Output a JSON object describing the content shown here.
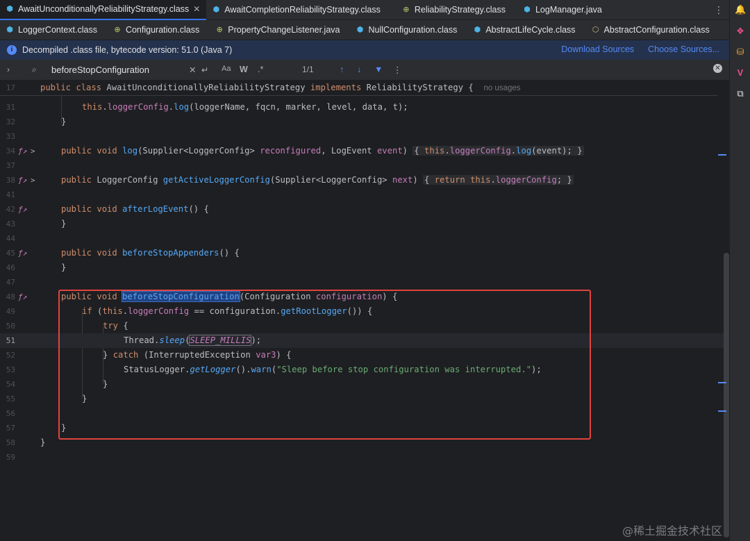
{
  "tabs_row1": [
    {
      "label": "AwaitUnconditionallyReliabilityStrategy.class",
      "icon": "class-icon",
      "active": true,
      "closable": true
    },
    {
      "label": "AwaitCompletionReliabilityStrategy.class",
      "icon": "class-icon"
    },
    {
      "label": "ReliabilityStrategy.class",
      "icon": "interface-icon"
    },
    {
      "label": "LogManager.java",
      "icon": "class-icon"
    }
  ],
  "tabs_row2": [
    {
      "label": "LoggerContext.class",
      "icon": "class-icon"
    },
    {
      "label": "Configuration.class",
      "icon": "interface-icon"
    },
    {
      "label": "PropertyChangeListener.java",
      "icon": "interface-icon"
    },
    {
      "label": "NullConfiguration.class",
      "icon": "class-icon"
    },
    {
      "label": "AbstractLifeCycle.class",
      "icon": "class-icon"
    },
    {
      "label": "AbstractConfiguration.class",
      "icon": "abstract-class-icon"
    }
  ],
  "infobar": {
    "message": "Decompiled .class file, bytecode version: 51.0 (Java 7)",
    "download_sources": "Download Sources",
    "choose_sources": "Choose Sources..."
  },
  "findbar": {
    "query": "beforeStopConfiguration",
    "match_count": "1/1",
    "case_label": "Aa",
    "word_label": "W",
    "regex_label": ".*"
  },
  "sticky": {
    "line_number": "17",
    "signature_kw1": "public",
    "signature_kw2": "class",
    "class_name": "AwaitUnconditionallyReliabilityStrategy",
    "implements_kw": "implements",
    "iface_name": "ReliabilityStrategy",
    "brace": "{",
    "hint": "no usages"
  },
  "lines": [
    {
      "n": "31"
    },
    {
      "n": "32"
    },
    {
      "n": "33"
    },
    {
      "n": "34"
    },
    {
      "n": "37"
    },
    {
      "n": "38"
    },
    {
      "n": "41"
    },
    {
      "n": "42"
    },
    {
      "n": "43"
    },
    {
      "n": "44"
    },
    {
      "n": "45"
    },
    {
      "n": "46"
    },
    {
      "n": "47"
    },
    {
      "n": "48"
    },
    {
      "n": "49"
    },
    {
      "n": "50"
    },
    {
      "n": "51"
    },
    {
      "n": "52"
    },
    {
      "n": "53"
    },
    {
      "n": "54"
    },
    {
      "n": "55"
    },
    {
      "n": "56"
    },
    {
      "n": "57"
    },
    {
      "n": "58"
    },
    {
      "n": "59"
    }
  ],
  "code": {
    "l31_prefix": "this",
    "l31_field": "loggerConfig",
    "l31_call": "log",
    "l31_args": "(loggerName, fqcn, marker, level, data, t);",
    "l34_kw": "public void",
    "l34_fn": "log",
    "l34_sig": "(Supplier<LoggerConfig> ",
    "l34_param": "reconfigured",
    "l34_sig2": ", LogEvent ",
    "l34_param2": "event",
    "l34_close": ") ",
    "l34_body_open": "{ ",
    "l34_this": "this",
    "l34_field": "loggerConfig",
    "l34_call": "log",
    "l34_args": "(event); ",
    "l34_body_close": "}",
    "l38_kw": "public",
    "l38_type": "LoggerConfig",
    "l38_fn": "getActiveLoggerConfig",
    "l38_sig": "(Supplier<LoggerConfig> ",
    "l38_param": "next",
    "l38_close": ") ",
    "l38_body_open": "{ ",
    "l38_return": "return",
    "l38_this": "this",
    "l38_field": "loggerConfig",
    "l38_end": "; ",
    "l38_body_close": "}",
    "l42_kw": "public void",
    "l42_fn": "afterLogEvent",
    "l42_rest": "() {",
    "l45_kw": "public void",
    "l45_fn": "beforeStopAppenders",
    "l45_rest": "() {",
    "l48_kw": "public void",
    "l48_fn": "beforeStopConfiguration",
    "l48_sig": "(Configuration ",
    "l48_param": "configuration",
    "l48_rest": ") {",
    "l49_if": "if",
    "l49_open": " (",
    "l49_this": "this",
    "l49_field": "loggerConfig",
    "l49_eq": " == configuration.",
    "l49_fn": "getRootLogger",
    "l49_rest": "()) {",
    "l50_try": "try",
    "l50_rest": " {",
    "l51_type": "Thread.",
    "l51_fn": "sleep",
    "l51_open": "(",
    "l51_const": "SLEEP_MILLIS",
    "l51_rest": ");",
    "l52_open": "} ",
    "l52_catch": "catch",
    "l52_rest": " (InterruptedException ",
    "l52_var": "var3",
    "l52_close": ") {",
    "l53_type": "StatusLogger.",
    "l53_fn": "getLogger",
    "l53_mid": "().",
    "l53_fn2": "warn",
    "l53_open": "(",
    "l53_str": "\"Sleep before stop configuration was interrupted.\"",
    "l53_rest": ");",
    "brace_close": "}",
    "dot": ".",
    "fold_marker": ">",
    "gutter_marker": "f"
  },
  "watermark": "@稀土掘金技术社区",
  "colors": {
    "accent": "#3574f0",
    "highlight_box": "#e0443e",
    "keyword": "#cf8e6d",
    "function": "#56a8f5",
    "field": "#c77dbb",
    "string": "#6aab73"
  }
}
